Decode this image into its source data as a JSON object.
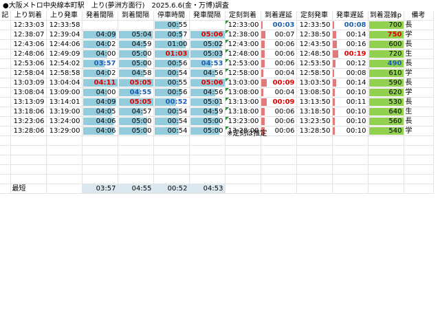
{
  "title": "●大阪メトロ中央線本町駅　上り(夢洲方面行)　2025.6.6(金・万博)調査",
  "headers": [
    "記",
    "上り到着",
    "上り発車",
    "発着間隔",
    "到着間隔",
    "停車時間",
    "発車間隔",
    "定刻到着",
    "到着遅延",
    "定刻発車",
    "発車遅延",
    "到着混雑p",
    "備考"
  ],
  "rows": [
    {
      "arr": "12:33:03",
      "dep": "12:33:58",
      "fa": "",
      "ai": "",
      "dw": "00:55",
      "di": "",
      "sa": "12:33:00",
      "ad": "00:03",
      "sd": "12:33:50",
      "dd": "00:08",
      "cr": "700",
      "nt": "長"
    },
    {
      "arr": "12:38:07",
      "dep": "12:39:04",
      "fa": "04:09",
      "ai": "05:04",
      "dw": "00:57",
      "di": "05:06",
      "sa": "12:38:00",
      "ad": "00:07",
      "sd": "12:38:50",
      "dd": "00:14",
      "cr": "750",
      "nt": "学"
    },
    {
      "arr": "12:43:06",
      "dep": "12:44:06",
      "fa": "04:02",
      "ai": "04:59",
      "dw": "01:00",
      "di": "05:02",
      "sa": "12:43:00",
      "ad": "00:06",
      "sd": "12:43:50",
      "dd": "00:16",
      "cr": "600",
      "nt": "長"
    },
    {
      "arr": "12:48:06",
      "dep": "12:49:09",
      "fa": "04:00",
      "ai": "05:00",
      "dw": "01:03",
      "di": "05:03",
      "sa": "12:48:00",
      "ad": "00:06",
      "sd": "12:48:50",
      "dd": "00:19",
      "cr": "720",
      "nt": "生"
    },
    {
      "arr": "12:53:06",
      "dep": "12:54:02",
      "fa": "03:57",
      "ai": "05:00",
      "dw": "00:56",
      "di": "04:53",
      "sa": "12:53:00",
      "ad": "00:06",
      "sd": "12:53:50",
      "dd": "00:12",
      "cr": "490",
      "nt": "長"
    },
    {
      "arr": "12:58:04",
      "dep": "12:58:58",
      "fa": "04:02",
      "ai": "04:58",
      "dw": "00:54",
      "di": "04:56",
      "sa": "12:58:00",
      "ad": "00:04",
      "sd": "12:58:50",
      "dd": "00:08",
      "cr": "610",
      "nt": "学"
    },
    {
      "arr": "13:03:09",
      "dep": "13:04:04",
      "fa": "04:11",
      "ai": "05:05",
      "dw": "00:55",
      "di": "05:06",
      "sa": "13:03:00",
      "ad": "00:09",
      "sd": "13:03:50",
      "dd": "00:14",
      "cr": "590",
      "nt": "長"
    },
    {
      "arr": "13:08:04",
      "dep": "13:09:00",
      "fa": "04:00",
      "ai": "04:55",
      "dw": "00:56",
      "di": "04:56",
      "sa": "13:08:00",
      "ad": "00:04",
      "sd": "13:08:50",
      "dd": "00:10",
      "cr": "620",
      "nt": "学"
    },
    {
      "arr": "13:13:09",
      "dep": "13:14:01",
      "fa": "04:09",
      "ai": "05:05",
      "dw": "00:52",
      "di": "05:01",
      "sa": "13:13:00",
      "ad": "00:09",
      "sd": "13:13:50",
      "dd": "00:11",
      "cr": "530",
      "nt": "長"
    },
    {
      "arr": "13:18:06",
      "dep": "13:19:00",
      "fa": "04:05",
      "ai": "04:57",
      "dw": "00:54",
      "di": "04:59",
      "sa": "13:18:00",
      "ad": "00:06",
      "sd": "13:18:50",
      "dd": "00:10",
      "cr": "640",
      "nt": "生"
    },
    {
      "arr": "13:23:06",
      "dep": "13:24:00",
      "fa": "04:06",
      "ai": "05:00",
      "dw": "00:54",
      "di": "05:00",
      "sa": "13:23:00",
      "ad": "00:06",
      "sd": "13:23:50",
      "dd": "00:10",
      "cr": "560",
      "nt": "長"
    },
    {
      "arr": "13:28:06",
      "dep": "13:29:00",
      "fa": "04:06",
      "ai": "05:00",
      "dw": "00:54",
      "di": "05:00",
      "sa": "13:28:00",
      "ad": "00:06",
      "sd": "13:28:50",
      "dd": "00:10",
      "cr": "540",
      "nt": "学"
    }
  ],
  "note": "※定刻は推定",
  "summary": {
    "label": "最短",
    "fa": "03:57",
    "ai": "04:55",
    "dw": "00:52",
    "di": "04:53"
  },
  "colors": {
    "data_bar": "#93cddd",
    "crowd_bar": "#92d050",
    "delay_bar": "#e07b7b",
    "max_text": "#e00000",
    "min_text": "#1f5fb0"
  },
  "highlights": {
    "max": {
      "fa": [
        6
      ],
      "ai": [
        6,
        8
      ],
      "dw": [
        3
      ],
      "di": [
        1,
        6
      ],
      "ad": [
        6,
        8
      ],
      "dd": [
        3
      ],
      "cr": [
        1
      ]
    },
    "min": {
      "fa": [
        4
      ],
      "ai": [
        7
      ],
      "dw": [
        8
      ],
      "di": [
        4
      ],
      "ad": [
        0
      ],
      "dd": [
        0
      ],
      "cr": [
        4
      ]
    }
  }
}
